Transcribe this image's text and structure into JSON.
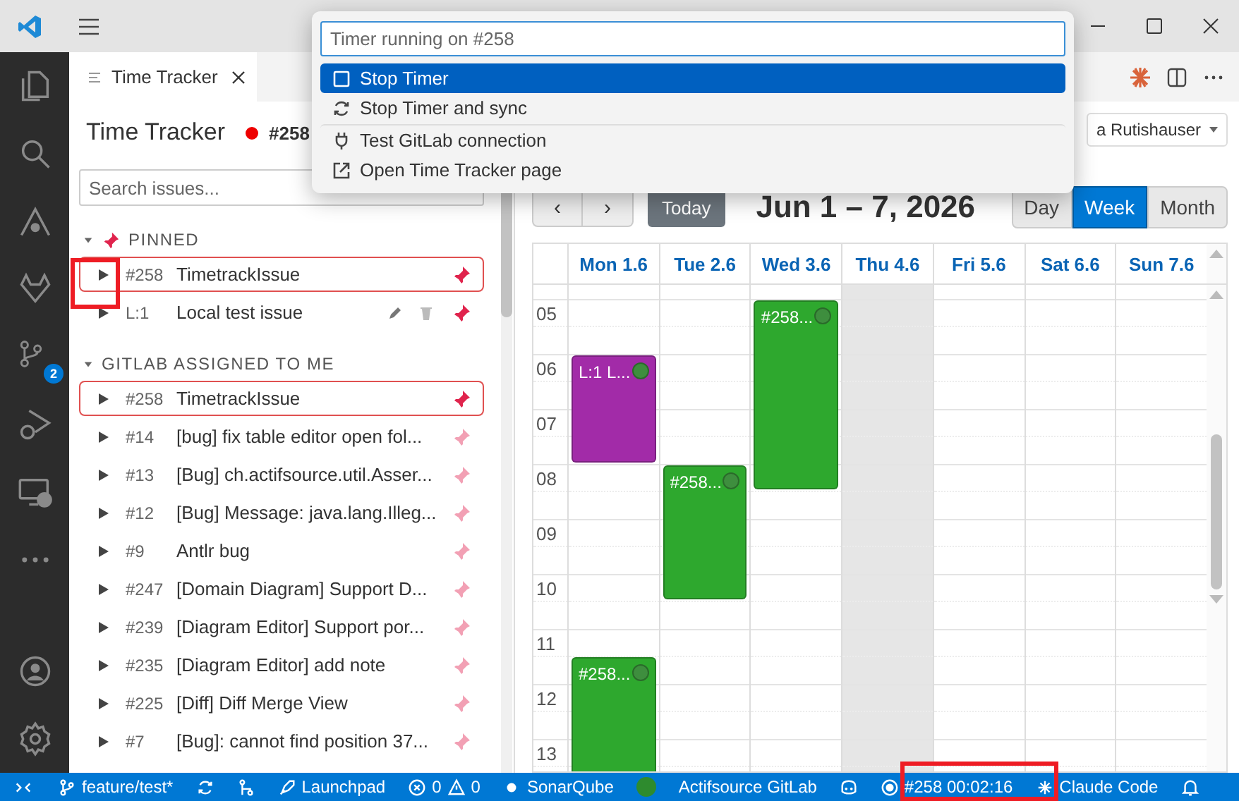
{
  "activity_bar": {
    "items": [
      {
        "kind": "files",
        "selected": false
      },
      {
        "kind": "search",
        "selected": false
      },
      {
        "kind": "peak",
        "selected": false
      },
      {
        "kind": "fox",
        "selected": false
      },
      {
        "kind": "branch",
        "selected": false,
        "badge": "2"
      },
      {
        "kind": "debug",
        "selected": false
      },
      {
        "kind": "remote",
        "selected": false
      },
      {
        "kind": "more",
        "selected": false
      }
    ],
    "bottom": [
      {
        "kind": "account"
      },
      {
        "kind": "settings"
      }
    ]
  },
  "tab": {
    "label": "Time Tracker"
  },
  "panel": {
    "title": "Time Tracker",
    "running_issue": "#258",
    "search": {
      "placeholder": "Search issues..."
    },
    "groups": [
      {
        "label": "PINNED",
        "pinned_icon": true,
        "expanded": true,
        "issues": [
          {
            "id": "#258",
            "title": "TimetrackIssue",
            "active": true,
            "pinned": true,
            "editable": false
          },
          {
            "id": "L:1",
            "title": "Local test issue",
            "active": false,
            "pinned": true,
            "editable": true
          }
        ]
      },
      {
        "label": "GITLAB ASSIGNED TO ME",
        "pinned_icon": false,
        "expanded": true,
        "issues": [
          {
            "id": "#258",
            "title": "TimetrackIssue",
            "active": true,
            "pinned": true,
            "editable": false
          },
          {
            "id": "#14",
            "title": "[bug] fix table editor open fol...",
            "active": false,
            "pinned": false,
            "editable": false
          },
          {
            "id": "#13",
            "title": "[Bug] ch.actifsource.util.Asser...",
            "active": false,
            "pinned": false,
            "editable": false
          },
          {
            "id": "#12",
            "title": "[Bug] Message: java.lang.Illeg...",
            "active": false,
            "pinned": false,
            "editable": false
          },
          {
            "id": "#9",
            "title": "Antlr bug",
            "active": false,
            "pinned": false,
            "editable": false
          },
          {
            "id": "#247",
            "title": "[Domain Diagram] Support D...",
            "active": false,
            "pinned": false,
            "editable": false
          },
          {
            "id": "#239",
            "title": "[Diagram Editor] Support por...",
            "active": false,
            "pinned": false,
            "editable": false
          },
          {
            "id": "#235",
            "title": "[Diagram Editor] add note",
            "active": false,
            "pinned": false,
            "editable": false
          },
          {
            "id": "#225",
            "title": "[Diff] Diff Merge View",
            "active": false,
            "pinned": false,
            "editable": false
          },
          {
            "id": "#7",
            "title": "[Bug]: cannot find position 37...",
            "active": false,
            "pinned": false,
            "editable": false
          }
        ]
      }
    ]
  },
  "calendar": {
    "user": "a Rutishauser",
    "nav": [
      "‹",
      "›"
    ],
    "today_button": "Today",
    "range": "Jun 1 – 7, 2026",
    "views": [
      {
        "label": "Day",
        "selected": false
      },
      {
        "label": "Week",
        "selected": true
      },
      {
        "label": "Month",
        "selected": false
      }
    ],
    "days": [
      {
        "label": "Mon 1.6",
        "shaded": false,
        "events": [
          {
            "label": "L:1 L...",
            "color": "#a22ba8"
          },
          {
            "label": "#258...",
            "color": "#2ea82e"
          }
        ]
      },
      {
        "label": "Tue 2.6",
        "shaded": false,
        "events": [
          {
            "label": "#258...",
            "color": "#2ea82e"
          }
        ]
      },
      {
        "label": "Wed 3.6",
        "shaded": false,
        "events": [
          {
            "label": "#258...",
            "color": "#2ea82e"
          }
        ]
      },
      {
        "label": "Thu 4.6",
        "shaded": true
      },
      {
        "label": "Fri 5.6",
        "shaded": false
      },
      {
        "label": "Sat 6.6",
        "shaded": false
      },
      {
        "label": "Sun 7.6",
        "shaded": false
      }
    ],
    "hours": [
      "05",
      "06",
      "07",
      "08",
      "09",
      "10",
      "11",
      "12",
      "13"
    ]
  },
  "quick_pick": {
    "placeholder": "Timer running on #258",
    "items": [
      {
        "kind": "stop",
        "label": "Stop Timer",
        "selected": true,
        "separator_before": false
      },
      {
        "kind": "sync",
        "label": "Stop Timer and sync",
        "selected": false,
        "separator_before": false
      },
      {
        "kind": "plug",
        "label": "Test GitLab connection",
        "selected": false,
        "separator_before": true
      },
      {
        "kind": "external",
        "label": "Open Time Tracker page",
        "selected": false,
        "separator_before": false
      }
    ]
  },
  "status_bar": {
    "items": [
      {
        "kind": "remote"
      },
      {
        "kind": "branch",
        "text": "feature/test*"
      },
      {
        "kind": "sync"
      },
      {
        "kind": "graph"
      },
      {
        "kind": "rocket",
        "text": "Launchpad"
      },
      {
        "kind": "problems",
        "text": "0",
        "warnings": "0"
      },
      {
        "kind": "dot",
        "text": "SonarQube"
      },
      {
        "kind": "greendot"
      },
      {
        "kind": "plain",
        "text": "Actifsource GitLab"
      },
      {
        "kind": "copilot"
      },
      {
        "kind": "timer",
        "text": "#258 00:02:16"
      },
      {
        "kind": "claude",
        "text": "Claude Code"
      },
      {
        "kind": "bell"
      }
    ]
  }
}
